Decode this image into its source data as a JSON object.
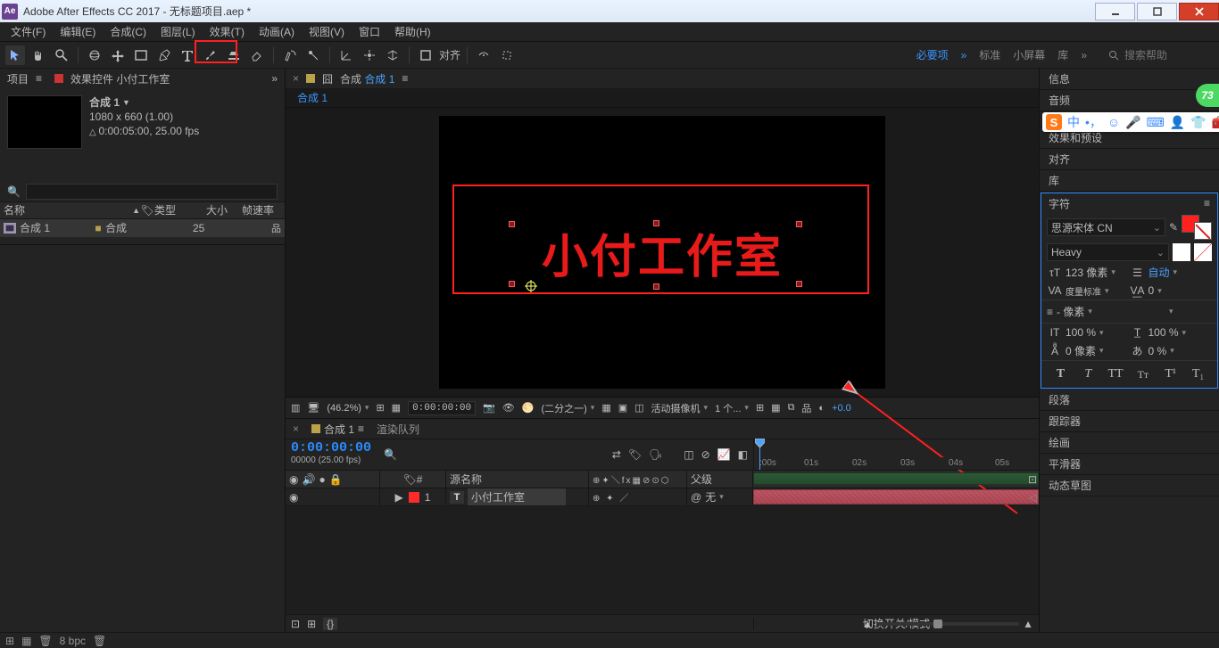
{
  "app": {
    "title": "Adobe After Effects CC 2017 - 无标题项目.aep *"
  },
  "menu": [
    "文件(F)",
    "编辑(E)",
    "合成(C)",
    "图层(L)",
    "效果(T)",
    "动画(A)",
    "视图(V)",
    "窗口",
    "帮助(H)"
  ],
  "toolbar": {
    "snap_label": "对齐",
    "modes": {
      "essential": "必要项",
      "standard": "标准",
      "small": "小屏幕",
      "library": "库"
    },
    "search_placeholder": "搜索帮助"
  },
  "project": {
    "tab": "项目",
    "effect_controls": "效果控件 小付工作室",
    "comp_name": "合成 1",
    "res": "1080 x 660 (1.00)",
    "dur": "0:00:05:00, 25.00 fps",
    "cols": {
      "name": "名称",
      "type": "类型",
      "size": "大小",
      "fps": "帧速率"
    },
    "row": {
      "name": "合成 1",
      "type": "合成",
      "fps": "25"
    }
  },
  "comp": {
    "tab_prefix": "合成",
    "tab_name": "合成 1",
    "flow_name": "合成 1",
    "text_layer": "小付工作室"
  },
  "viewer_footer": {
    "zoom": "(46.2%)",
    "timecode": "0:00:00:00",
    "res": "(二分之一)",
    "camera": "活动摄像机",
    "views": "1 个...",
    "exposure": "+0.0"
  },
  "timeline": {
    "tab_name": "合成 1",
    "render_queue": "渲染队列",
    "timecode": "0:00:00:00",
    "tc_frames": "00000 (25.00 fps)",
    "cols": {
      "num": "#",
      "src": "源名称",
      "switches": "单 ✦ ╲ fx 囯 ⊘ ⊙ ⊕",
      "parent": "父级"
    },
    "layer": {
      "num": "1",
      "name": "小付工作室",
      "parent_none": "无"
    },
    "ticks": [
      ":00s",
      "01s",
      "02s",
      "03s",
      "04s",
      "05s"
    ],
    "footer_center": "切换开关/模式"
  },
  "right": {
    "panels": {
      "info": "信息",
      "audio": "音频",
      "fx": "效果和预设",
      "align": "对齐",
      "lib": "库",
      "para": "段落",
      "tracker": "跟踪器",
      "paint": "绘画",
      "smoother": "平滑器",
      "motion": "动态草图"
    },
    "char": {
      "title": "字符",
      "font": "思源宋体 CN",
      "weight": "Heavy",
      "size": "123 像素",
      "leading": "自动",
      "kerning": "度量标准",
      "tracking": "0",
      "leading_px": "- 像素",
      "vscale": "100 %",
      "hscale": "100 %",
      "baseline": "0 像素",
      "tsume": "0 %"
    }
  },
  "status": {
    "bpc": "8 bpc"
  },
  "ime": {
    "lang": "中"
  },
  "badge": "73"
}
